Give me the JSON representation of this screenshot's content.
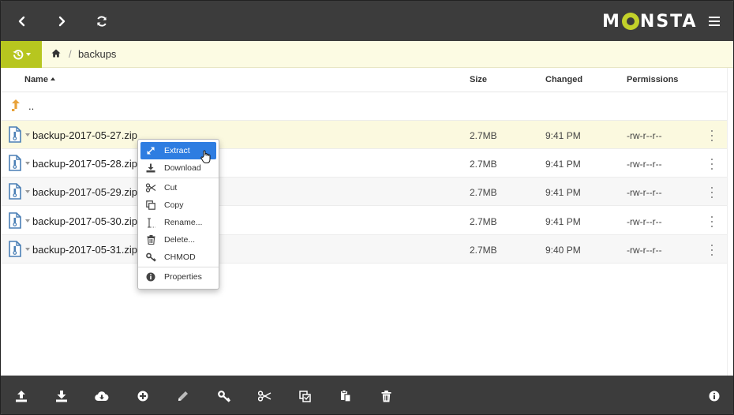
{
  "app": {
    "brand_prefix": "M",
    "brand_suffix": "NSTA",
    "brand_color": "#c3d22a"
  },
  "nav": {
    "back_icon": "chevron-left-icon",
    "forward_icon": "chevron-right-icon",
    "refresh_icon": "refresh-icon",
    "menu_icon": "hamburger-icon"
  },
  "breadcrumb": {
    "home_icon": "home-icon",
    "separator": "/",
    "current_dir": "backups"
  },
  "table": {
    "columns": {
      "name": "Name",
      "size": "Size",
      "changed": "Changed",
      "permissions": "Permissions"
    },
    "parent_label": "..",
    "rows": [
      {
        "name": "backup-2017-05-27.zip",
        "size": "2.7MB",
        "changed": "9:41 PM",
        "permissions": "-rw-r--r--"
      },
      {
        "name": "backup-2017-05-28.zip",
        "size": "2.7MB",
        "changed": "9:41 PM",
        "permissions": "-rw-r--r--"
      },
      {
        "name": "backup-2017-05-29.zip",
        "size": "2.7MB",
        "changed": "9:41 PM",
        "permissions": "-rw-r--r--"
      },
      {
        "name": "backup-2017-05-30.zip",
        "size": "2.7MB",
        "changed": "9:41 PM",
        "permissions": "-rw-r--r--"
      },
      {
        "name": "backup-2017-05-31.zip",
        "size": "2.7MB",
        "changed": "9:40 PM",
        "permissions": "-rw-r--r--"
      }
    ]
  },
  "context_menu": {
    "items": [
      {
        "label": "Extract",
        "icon": "expand-icon"
      },
      {
        "label": "Download",
        "icon": "download-icon"
      },
      {
        "label": "Cut",
        "icon": "scissors-icon"
      },
      {
        "label": "Copy",
        "icon": "copy-icon"
      },
      {
        "label": "Rename...",
        "icon": "text-cursor-icon"
      },
      {
        "label": "Delete...",
        "icon": "trash-icon"
      },
      {
        "label": "CHMOD",
        "icon": "key-icon"
      },
      {
        "label": "Properties",
        "icon": "info-icon"
      }
    ]
  },
  "toolbar": {
    "icons": [
      "upload-icon",
      "download-icon",
      "cloud-download-icon",
      "add-icon",
      "pencil-icon",
      "key-icon",
      "scissors-icon",
      "copy-icon",
      "paste-icon",
      "trash-icon",
      "info-icon"
    ]
  },
  "colors": {
    "topbar": "#3c3c3c",
    "accent": "#b7c61f",
    "crumb_bg": "#fcfbe3",
    "selection": "#2e7de1",
    "parent_arrow": "#e8a23a",
    "file_icon": "#4a7fb5"
  }
}
